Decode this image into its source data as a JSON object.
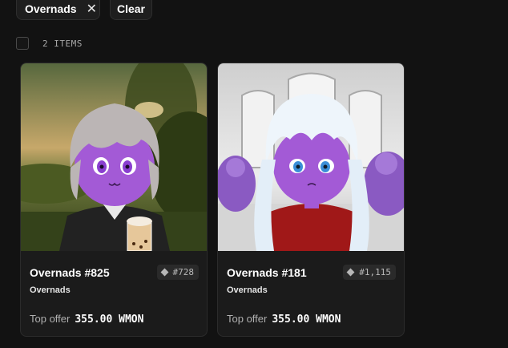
{
  "filters": {
    "active_chip_label": "Overnads",
    "remove_icon": "close-icon",
    "clear_label": "Clear"
  },
  "results": {
    "count_label": "2 ITEMS"
  },
  "items": [
    {
      "name": "Overnads #825",
      "rank": "#728",
      "collection": "Overnads",
      "offer_label": "Top offer",
      "offer_value": "355.00 WMON"
    },
    {
      "name": "Overnads #181",
      "rank": "#1,115",
      "collection": "Overnads",
      "offer_label": "Top offer",
      "offer_value": "355.00 WMON"
    }
  ],
  "colors": {
    "background": "#121212",
    "card": "#1b1b1b",
    "avatar_skin": "#a35ad6"
  }
}
